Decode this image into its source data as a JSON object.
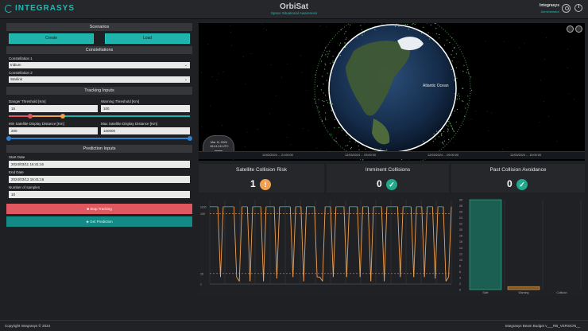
{
  "header": {
    "logo": "INTEGRASYS",
    "title": "OrbiSat",
    "subtitle": "Space Situational Awareness",
    "user_name": "Integrasys",
    "user_role": "Administrator"
  },
  "scenarios": {
    "title": "Scenarios",
    "create_label": "Create",
    "load_label": "Load"
  },
  "constellations": {
    "title": "Constellations",
    "c1_label": "Constellation 1",
    "c1_value": "Iridium",
    "c2_label": "Constellation 2",
    "c2_value": "Starlink"
  },
  "tracking": {
    "title": "Tracking Inputs",
    "danger_label": "Danger Threshold [Km]",
    "danger_value": "15",
    "warning_label": "Warning Threshold [Km]",
    "warning_value": "100",
    "danger_slider": 0.12,
    "warning_slider": 0.3,
    "min_label": "Min Satellite Display Distance [Km]",
    "min_value": "200",
    "max_label": "Max Satellite Display Distance [Km]",
    "max_value": "100000",
    "range_slider": [
      0.0,
      1.0
    ]
  },
  "prediction": {
    "title": "Prediction Inputs",
    "start_label": "Start Date",
    "start_value": "2024/03/11 16:41:16",
    "end_label": "End Date",
    "end_value": "2024/03/12 16:41:16",
    "samples_label": "Number of samples",
    "samples_value": "10"
  },
  "actions": {
    "stop_label": "Stop Tracking",
    "predict_label": "Get Prediction"
  },
  "viewer": {
    "clock_date": "Mar 11 2024",
    "clock_time": "16:41:16 UTC",
    "timeline_ticks": [
      "11/03/2024 ... 21:00:00",
      "12/03/2024 ... 03:00:00",
      "12/03/2024 ... 09:00:00",
      "12/03/2024 ... 15:00:00"
    ],
    "ocean_label": "Atlantic Ocean"
  },
  "cards": {
    "risk_title": "Satellite Collision Risk",
    "risk_value": "1",
    "imminent_title": "Imminent Collisions",
    "imminent_value": "0",
    "past_title": "Past Collision Avoidance",
    "past_value": "0"
  },
  "colors": {
    "accent": "#1fb3ac",
    "danger": "#e0585f",
    "warning": "#f0a050",
    "ok": "#22a88a"
  },
  "chart_data": [
    {
      "type": "line",
      "series": [
        {
          "values": [
            1100,
            1100,
            1100,
            1100,
            100,
            1100,
            1100,
            1100,
            1100,
            1100,
            100,
            40,
            1100,
            1100,
            1100,
            40,
            1100,
            1100,
            1100,
            1100,
            40,
            1100,
            1100,
            1100,
            1100,
            80,
            1100,
            1100,
            1100,
            1100,
            1100,
            100,
            1100,
            1100,
            1100,
            40,
            1100,
            1100,
            1100,
            1100,
            100,
            100,
            40,
            1100,
            1100,
            1100,
            100,
            1100,
            1100,
            1100,
            1100,
            100,
            1100,
            1100,
            1100,
            1100,
            100,
            1100,
            1100,
            1100,
            40,
            1100,
            1100,
            1100,
            1100,
            40,
            1100,
            1100,
            1100,
            1100,
            1100,
            100,
            1100,
            1100,
            1100,
            1100,
            100,
            1100,
            1100,
            1100,
            100,
            1100,
            1100,
            1100,
            80,
            1100,
            1100,
            1100,
            40,
            100,
            1100
          ]
        }
      ],
      "thresholds": [
        100,
        15
      ],
      "ylim": [
        0,
        1200
      ],
      "yticks": [
        "1100",
        "100",
        "15",
        "1"
      ]
    },
    {
      "type": "bar",
      "categories": [
        "Safe",
        "Warning",
        "Collision"
      ],
      "values": [
        30,
        1,
        0
      ],
      "ylim": [
        0,
        30
      ],
      "yticks": [
        "0",
        "2",
        "4",
        "6",
        "8",
        "10",
        "12",
        "14",
        "16",
        "18",
        "20",
        "22",
        "24",
        "26",
        "28",
        "30"
      ]
    }
  ],
  "footer": {
    "copyright": "Copyright Integrasys © 2024",
    "version": "Integrasys Beam Budget v___RB_VERSION__"
  }
}
